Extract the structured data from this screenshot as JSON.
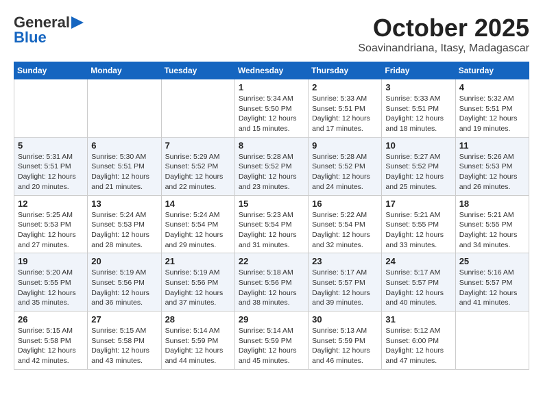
{
  "logo": {
    "general": "General",
    "blue": "Blue"
  },
  "header": {
    "month": "October 2025",
    "location": "Soavinandriana, Itasy, Madagascar"
  },
  "weekdays": [
    "Sunday",
    "Monday",
    "Tuesday",
    "Wednesday",
    "Thursday",
    "Friday",
    "Saturday"
  ],
  "weeks": [
    [
      {
        "day": "",
        "info": ""
      },
      {
        "day": "",
        "info": ""
      },
      {
        "day": "",
        "info": ""
      },
      {
        "day": "1",
        "info": "Sunrise: 5:34 AM\nSunset: 5:50 PM\nDaylight: 12 hours\nand 15 minutes."
      },
      {
        "day": "2",
        "info": "Sunrise: 5:33 AM\nSunset: 5:51 PM\nDaylight: 12 hours\nand 17 minutes."
      },
      {
        "day": "3",
        "info": "Sunrise: 5:33 AM\nSunset: 5:51 PM\nDaylight: 12 hours\nand 18 minutes."
      },
      {
        "day": "4",
        "info": "Sunrise: 5:32 AM\nSunset: 5:51 PM\nDaylight: 12 hours\nand 19 minutes."
      }
    ],
    [
      {
        "day": "5",
        "info": "Sunrise: 5:31 AM\nSunset: 5:51 PM\nDaylight: 12 hours\nand 20 minutes."
      },
      {
        "day": "6",
        "info": "Sunrise: 5:30 AM\nSunset: 5:51 PM\nDaylight: 12 hours\nand 21 minutes."
      },
      {
        "day": "7",
        "info": "Sunrise: 5:29 AM\nSunset: 5:52 PM\nDaylight: 12 hours\nand 22 minutes."
      },
      {
        "day": "8",
        "info": "Sunrise: 5:28 AM\nSunset: 5:52 PM\nDaylight: 12 hours\nand 23 minutes."
      },
      {
        "day": "9",
        "info": "Sunrise: 5:28 AM\nSunset: 5:52 PM\nDaylight: 12 hours\nand 24 minutes."
      },
      {
        "day": "10",
        "info": "Sunrise: 5:27 AM\nSunset: 5:52 PM\nDaylight: 12 hours\nand 25 minutes."
      },
      {
        "day": "11",
        "info": "Sunrise: 5:26 AM\nSunset: 5:53 PM\nDaylight: 12 hours\nand 26 minutes."
      }
    ],
    [
      {
        "day": "12",
        "info": "Sunrise: 5:25 AM\nSunset: 5:53 PM\nDaylight: 12 hours\nand 27 minutes."
      },
      {
        "day": "13",
        "info": "Sunrise: 5:24 AM\nSunset: 5:53 PM\nDaylight: 12 hours\nand 28 minutes."
      },
      {
        "day": "14",
        "info": "Sunrise: 5:24 AM\nSunset: 5:54 PM\nDaylight: 12 hours\nand 29 minutes."
      },
      {
        "day": "15",
        "info": "Sunrise: 5:23 AM\nSunset: 5:54 PM\nDaylight: 12 hours\nand 31 minutes."
      },
      {
        "day": "16",
        "info": "Sunrise: 5:22 AM\nSunset: 5:54 PM\nDaylight: 12 hours\nand 32 minutes."
      },
      {
        "day": "17",
        "info": "Sunrise: 5:21 AM\nSunset: 5:55 PM\nDaylight: 12 hours\nand 33 minutes."
      },
      {
        "day": "18",
        "info": "Sunrise: 5:21 AM\nSunset: 5:55 PM\nDaylight: 12 hours\nand 34 minutes."
      }
    ],
    [
      {
        "day": "19",
        "info": "Sunrise: 5:20 AM\nSunset: 5:55 PM\nDaylight: 12 hours\nand 35 minutes."
      },
      {
        "day": "20",
        "info": "Sunrise: 5:19 AM\nSunset: 5:56 PM\nDaylight: 12 hours\nand 36 minutes."
      },
      {
        "day": "21",
        "info": "Sunrise: 5:19 AM\nSunset: 5:56 PM\nDaylight: 12 hours\nand 37 minutes."
      },
      {
        "day": "22",
        "info": "Sunrise: 5:18 AM\nSunset: 5:56 PM\nDaylight: 12 hours\nand 38 minutes."
      },
      {
        "day": "23",
        "info": "Sunrise: 5:17 AM\nSunset: 5:57 PM\nDaylight: 12 hours\nand 39 minutes."
      },
      {
        "day": "24",
        "info": "Sunrise: 5:17 AM\nSunset: 5:57 PM\nDaylight: 12 hours\nand 40 minutes."
      },
      {
        "day": "25",
        "info": "Sunrise: 5:16 AM\nSunset: 5:57 PM\nDaylight: 12 hours\nand 41 minutes."
      }
    ],
    [
      {
        "day": "26",
        "info": "Sunrise: 5:15 AM\nSunset: 5:58 PM\nDaylight: 12 hours\nand 42 minutes."
      },
      {
        "day": "27",
        "info": "Sunrise: 5:15 AM\nSunset: 5:58 PM\nDaylight: 12 hours\nand 43 minutes."
      },
      {
        "day": "28",
        "info": "Sunrise: 5:14 AM\nSunset: 5:59 PM\nDaylight: 12 hours\nand 44 minutes."
      },
      {
        "day": "29",
        "info": "Sunrise: 5:14 AM\nSunset: 5:59 PM\nDaylight: 12 hours\nand 45 minutes."
      },
      {
        "day": "30",
        "info": "Sunrise: 5:13 AM\nSunset: 5:59 PM\nDaylight: 12 hours\nand 46 minutes."
      },
      {
        "day": "31",
        "info": "Sunrise: 5:12 AM\nSunset: 6:00 PM\nDaylight: 12 hours\nand 47 minutes."
      },
      {
        "day": "",
        "info": ""
      }
    ]
  ]
}
